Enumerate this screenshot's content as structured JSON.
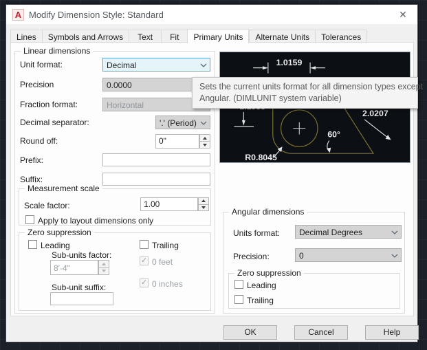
{
  "window": {
    "icon_letter": "A",
    "title": "Modify Dimension Style: Standard",
    "close_glyph": "✕"
  },
  "tabs": [
    {
      "label": "Lines",
      "active": false
    },
    {
      "label": "Symbols and Arrows",
      "active": false
    },
    {
      "label": "Text",
      "active": false
    },
    {
      "label": "Fit",
      "active": false
    },
    {
      "label": "Primary Units",
      "active": true
    },
    {
      "label": "Alternate Units",
      "active": false
    },
    {
      "label": "Tolerances",
      "active": false
    }
  ],
  "linear": {
    "group_label": "Linear dimensions",
    "unit_format": {
      "label": "Unit format:",
      "value": "Decimal",
      "state": "focused"
    },
    "precision": {
      "label": "Precision",
      "value": "0.0000"
    },
    "fraction_format": {
      "label": "Fraction format:",
      "value": "Horizontal",
      "state": "disabled"
    },
    "decimal_separator": {
      "label": "Decimal separator:",
      "value": "'.' (Period)"
    },
    "round_off": {
      "label": "Round off:",
      "value": "0\""
    },
    "prefix": {
      "label": "Prefix:",
      "value": ""
    },
    "suffix": {
      "label": "Suffix:",
      "value": ""
    }
  },
  "measurement_scale": {
    "group_label": "Measurement scale",
    "scale_factor": {
      "label": "Scale factor:",
      "value": "1.00"
    },
    "apply_layout": {
      "label": "Apply to layout dimensions only",
      "checked": false
    }
  },
  "zero_suppression": {
    "group_label": "Zero suppression",
    "leading": {
      "label": "Leading",
      "checked": false
    },
    "trailing": {
      "label": "Trailing",
      "checked": false
    },
    "sub_units_factor": {
      "label": "Sub-units factor:",
      "value": "8'-4\"",
      "state": "disabled"
    },
    "zero_feet": {
      "label": "0 feet",
      "checked": true,
      "state": "disabled"
    },
    "zero_inches": {
      "label": "0 inches",
      "checked": true,
      "state": "disabled"
    },
    "sub_unit_suffix": {
      "label": "Sub-unit suffix:",
      "value": ""
    }
  },
  "tooltip": {
    "line1": "Sets the current units format for all dimension types except",
    "line2": "Angular. (DIMLUNIT system variable)"
  },
  "preview": {
    "dim_top": "1.0159",
    "dim_left": "1.1955",
    "dim_diagonal": "2.0207",
    "angle": "60°",
    "radius": "R0.8045"
  },
  "angular": {
    "group_label": "Angular dimensions",
    "units_format": {
      "label": "Units format:",
      "value": "Decimal Degrees"
    },
    "precision": {
      "label": "Precision:",
      "value": "0"
    },
    "zero_suppression": {
      "group_label": "Zero suppression",
      "leading": {
        "label": "Leading",
        "checked": false
      },
      "trailing": {
        "label": "Trailing",
        "checked": false
      }
    }
  },
  "buttons": {
    "ok": "OK",
    "cancel": "Cancel",
    "help": "Help"
  },
  "colors": {
    "focus_highlight": "#e5f3fb",
    "focus_border": "#5ca3d9",
    "preview_background": "#0c0f13",
    "preview_line_gold": "#7e7434",
    "canvas_background": "#1c2028",
    "dialog_background": "#f0f0f0"
  }
}
